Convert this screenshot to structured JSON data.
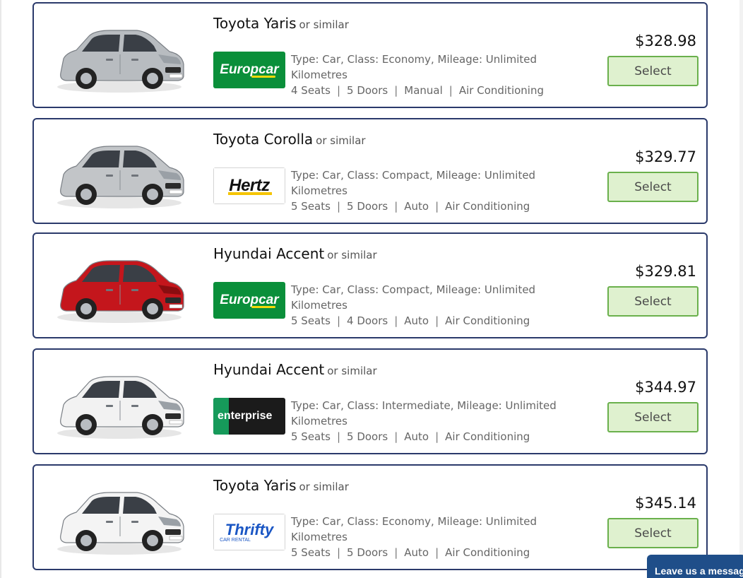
{
  "results": [
    {
      "car": "Toyota Yaris",
      "similar": "or similar",
      "supplier": "Europcar",
      "meta": "Type: Car, Class: Economy, Mileage: Unlimited Kilometres",
      "features": [
        "4 Seats",
        "5 Doors",
        "Manual",
        "Air Conditioning"
      ],
      "separator": "|",
      "price": "$328.98",
      "select_label": "Select",
      "car_color": "#b8bcc0"
    },
    {
      "car": "Toyota Corolla",
      "similar": "or similar",
      "supplier": "Hertz",
      "meta": "Type: Car, Class: Compact, Mileage: Unlimited Kilometres",
      "features": [
        "5 Seats",
        "5 Doors",
        "Auto",
        "Air Conditioning"
      ],
      "separator": "|",
      "price": "$329.77",
      "select_label": "Select",
      "car_color": "#c2c5c8"
    },
    {
      "car": "Hyundai Accent",
      "similar": "or similar",
      "supplier": "Europcar",
      "meta": "Type: Car, Class: Compact, Mileage: Unlimited Kilometres",
      "features": [
        "5 Seats",
        "4 Doors",
        "Auto",
        "Air Conditioning"
      ],
      "separator": "|",
      "price": "$329.81",
      "select_label": "Select",
      "car_color": "#c4161c"
    },
    {
      "car": "Hyundai Accent",
      "similar": "or similar",
      "supplier": "Enterprise",
      "meta": "Type: Car, Class: Intermediate, Mileage: Unlimited Kilometres",
      "features": [
        "5 Seats",
        "5 Doors",
        "Auto",
        "Air Conditioning"
      ],
      "separator": "|",
      "price": "$344.97",
      "select_label": "Select",
      "car_color": "#f2f2f2"
    },
    {
      "car": "Toyota Yaris",
      "similar": "or similar",
      "supplier": "Thrifty",
      "meta": "Type: Car, Class: Economy, Mileage: Unlimited Kilometres",
      "features": [
        "5 Seats",
        "5 Doors",
        "Auto",
        "Air Conditioning"
      ],
      "separator": "|",
      "price": "$345.14",
      "select_label": "Select",
      "car_color": "#f4f4f4"
    }
  ],
  "logos": {
    "Europcar": {
      "text": "Europcar",
      "bg": "#0a8f3a",
      "fg": "#ffffff",
      "accent": "#f5d90a"
    },
    "Hertz": {
      "text": "Hertz",
      "bg": "#ffffff",
      "fg": "#111111",
      "accent": "#f5c400"
    },
    "Enterprise": {
      "text": "enterprise",
      "bg": "#1b1b1b",
      "fg": "#ffffff",
      "accent": "#169a5a"
    },
    "Thrifty": {
      "text": "Thrifty",
      "subtext": "CAR RENTAL",
      "bg": "#ffffff",
      "fg": "#1a56c4"
    }
  },
  "chat": {
    "label": "Leave us a message"
  },
  "colors": {
    "card_border": "#2b3a6b",
    "button_bg": "#dff1cf",
    "button_border": "#6ab04c"
  }
}
